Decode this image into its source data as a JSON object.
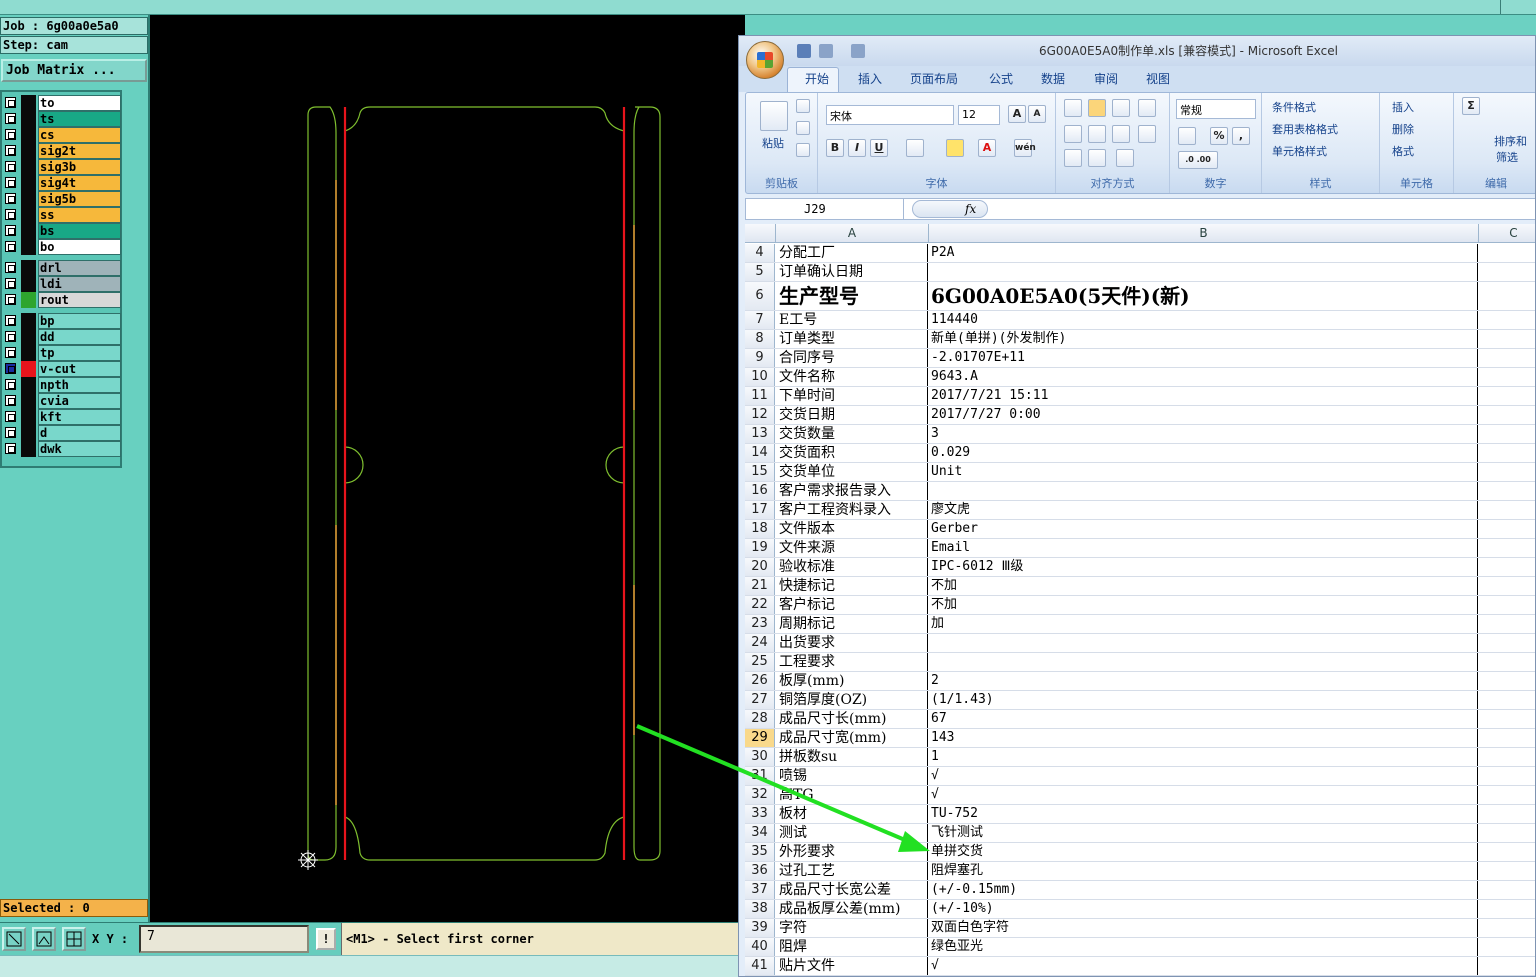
{
  "left_panel": {
    "job_label": "Job : 6g00a0e5a0",
    "step_label": "Step: cam",
    "job_matrix_button": "Job Matrix ...",
    "selected_label": "Selected : 0",
    "layers": [
      {
        "name": "to",
        "color": "#ffffff",
        "swatch": "#0a0a0a",
        "mark": "✎"
      },
      {
        "name": "ts",
        "color": "#18a886",
        "swatch": "#0a0a0a"
      },
      {
        "name": "cs",
        "color": "#f6b83b",
        "swatch": "#0a0a0a"
      },
      {
        "name": "sig2t",
        "color": "#f6b83b",
        "swatch": "#0a0a0a"
      },
      {
        "name": "sig3b",
        "color": "#f6b83b",
        "swatch": "#0a0a0a"
      },
      {
        "name": "sig4t",
        "color": "#f6b83b",
        "swatch": "#0a0a0a"
      },
      {
        "name": "sig5b",
        "color": "#f6b83b",
        "swatch": "#0a0a0a"
      },
      {
        "name": "ss",
        "color": "#f6b83b",
        "swatch": "#0a0a0a"
      },
      {
        "name": "bs",
        "color": "#18a886",
        "swatch": "#0a0a0a"
      },
      {
        "name": "bo",
        "color": "#ffffff",
        "swatch": "#0a0a0a",
        "mark": "✎"
      },
      {
        "name": "drl",
        "color": "#9fb3b9",
        "swatch": "#0a0a0a"
      },
      {
        "name": "ldi",
        "color": "#9fb3b9",
        "swatch": "#0a0a0a"
      },
      {
        "name": "rout",
        "color": "#d8d8d8",
        "swatch": "#2ea52e"
      },
      {
        "name": "bp",
        "color": "#79d7cb",
        "swatch": "#0a0a0a"
      },
      {
        "name": "dd",
        "color": "#79d7cb",
        "swatch": "#0a0a0a"
      },
      {
        "name": "tp",
        "color": "#79d7cb",
        "swatch": "#0a0a0a"
      },
      {
        "name": "v-cut",
        "color": "#79d7cb",
        "swatch": "#e8141c",
        "mark": "⊞",
        "selected": true
      },
      {
        "name": "npth",
        "color": "#79d7cb",
        "swatch": "#0a0a0a"
      },
      {
        "name": "cvia",
        "color": "#79d7cb",
        "swatch": "#0a0a0a"
      },
      {
        "name": "kft",
        "color": "#79d7cb",
        "swatch": "#0a0a0a"
      },
      {
        "name": "d",
        "color": "#79d7cb",
        "swatch": "#0a0a0a"
      },
      {
        "name": "dwk",
        "color": "#79d7cb",
        "swatch": "#0a0a0a"
      }
    ]
  },
  "bottom_bar": {
    "xy_label": "X Y :",
    "xy_value": "7",
    "exclaim": "!",
    "message": "<M1> - Select first corner"
  },
  "excel": {
    "title": "6G00A0E5A0制作单.xls  [兼容模式] - Microsoft Excel",
    "tabs": [
      "开始",
      "插入",
      "页面布局",
      "公式",
      "数据",
      "审阅",
      "视图"
    ],
    "groups": {
      "clipboard": "剪贴板",
      "font": "字体",
      "alignment": "对齐方式",
      "number": "数字",
      "styles": "样式",
      "cells": "单元格",
      "editing": "编辑"
    },
    "ribbon": {
      "paste": "粘贴",
      "font_name": "宋体",
      "font_size": "12",
      "number_format": "常规",
      "cond_format": "条件格式",
      "table_format": "套用表格格式",
      "cell_style": "单元格样式",
      "insert": "插入",
      "delete": "删除",
      "format": "格式",
      "sort_filter_1": "排序和",
      "sort_filter_2": "筛选",
      "bold": "B",
      "italic": "I",
      "underline": "U",
      "percent": "%",
      "comma": ",",
      "sigma": "Σ",
      "font_grow": "A",
      "font_color": "A",
      "wen": "wén",
      "inc_dec": ".0 .00"
    },
    "name_box": "J29",
    "fx": "fx",
    "columns": [
      "A",
      "B",
      "C"
    ],
    "rows": [
      {
        "n": "4",
        "a": "分配工厂",
        "b": "P2A"
      },
      {
        "n": "5",
        "a": "订单确认日期",
        "b": ""
      },
      {
        "n": "6",
        "a": "生产型号",
        "b": "6G00A0E5A0(5天件)(新)",
        "big": true
      },
      {
        "n": "7",
        "a": "E工号",
        "b": "114440"
      },
      {
        "n": "8",
        "a": "订单类型",
        "b": "新单(单拼)(外发制作)"
      },
      {
        "n": "9",
        "a": "合同序号",
        "b": "-2.01707E+11"
      },
      {
        "n": "10",
        "a": "文件名称",
        "b": "9643.A"
      },
      {
        "n": "11",
        "a": "下单时间",
        "b": "2017/7/21 15:11"
      },
      {
        "n": "12",
        "a": "交货日期",
        "b": "2017/7/27 0:00"
      },
      {
        "n": "13",
        "a": "交货数量",
        "b": "3"
      },
      {
        "n": "14",
        "a": "交货面积",
        "b": "0.029"
      },
      {
        "n": "15",
        "a": "交货单位",
        "b": "Unit"
      },
      {
        "n": "16",
        "a": "客户需求报告录入",
        "b": ""
      },
      {
        "n": "17",
        "a": "客户工程资料录入",
        "b": "廖文虎"
      },
      {
        "n": "18",
        "a": "文件版本",
        "b": "Gerber"
      },
      {
        "n": "19",
        "a": "文件来源",
        "b": "Email"
      },
      {
        "n": "20",
        "a": "验收标准",
        "b": "IPC-6012 Ⅲ级"
      },
      {
        "n": "21",
        "a": "快捷标记",
        "b": "不加"
      },
      {
        "n": "22",
        "a": "客户标记",
        "b": "不加"
      },
      {
        "n": "23",
        "a": "周期标记",
        "b": "加"
      },
      {
        "n": "24",
        "a": "出货要求",
        "b": ""
      },
      {
        "n": "25",
        "a": "工程要求",
        "b": ""
      },
      {
        "n": "26",
        "a": "板厚(mm)",
        "b": "2"
      },
      {
        "n": "27",
        "a": "铜箔厚度(OZ)",
        "b": " (1/1.43)"
      },
      {
        "n": "28",
        "a": "成品尺寸长(mm)",
        "b": "67"
      },
      {
        "n": "29",
        "a": "成品尺寸宽(mm)",
        "b": "143",
        "sel": true
      },
      {
        "n": "30",
        "a": "拼板数su",
        "b": "1"
      },
      {
        "n": "31",
        "a": "喷锡",
        "b": "√"
      },
      {
        "n": "32",
        "a": "高TG",
        "b": "√"
      },
      {
        "n": "33",
        "a": "板材",
        "b": "TU-752"
      },
      {
        "n": "34",
        "a": "测试",
        "b": "飞针测试"
      },
      {
        "n": "35",
        "a": "外形要求",
        "b": "单拼交货"
      },
      {
        "n": "36",
        "a": "过孔工艺",
        "b": "阻焊塞孔"
      },
      {
        "n": "37",
        "a": "成品尺寸长宽公差",
        "b": "(+/-0.15mm)"
      },
      {
        "n": "38",
        "a": "成品板厚公差(mm)",
        "b": "(+/-10%)"
      },
      {
        "n": "39",
        "a": "字符",
        "b": "双面白色字符"
      },
      {
        "n": "40",
        "a": "阻焊",
        "b": "绿色亚光"
      },
      {
        "n": "41",
        "a": "贴片文件",
        "b": "√"
      }
    ]
  },
  "colors": {
    "background": "#6cd1c2",
    "canvas": "#000000",
    "outline": "#7fbf2f",
    "vcut": "#e8141c",
    "arrow": "#22e022"
  }
}
